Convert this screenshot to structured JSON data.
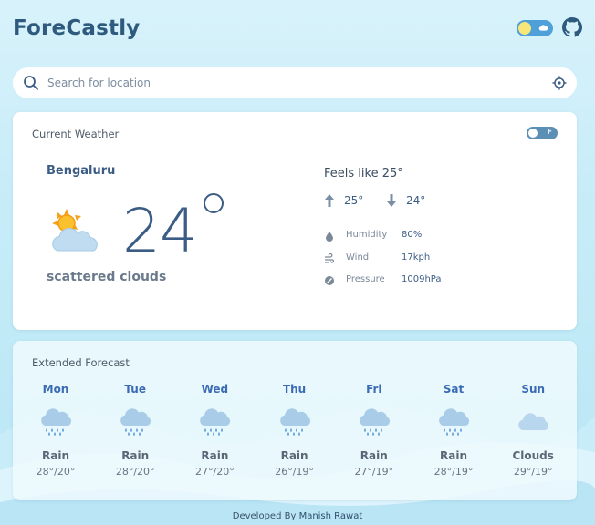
{
  "app": {
    "title": "ForeCastly"
  },
  "header": {
    "theme_toggle_icon": "sun-cloud-toggle-icon",
    "github_icon": "github-icon"
  },
  "search": {
    "placeholder": "Search for location",
    "value": ""
  },
  "current": {
    "title": "Current Weather",
    "unit_toggle_label": "F",
    "city": "Bengaluru",
    "temperature": "24",
    "description": "scattered clouds",
    "feels_like": "Feels like 25°",
    "max_temp": "25°",
    "min_temp": "24°",
    "stats": [
      {
        "label": "Humidity",
        "value": "80%",
        "icon": "droplet-icon"
      },
      {
        "label": "Wind",
        "value": "17kph",
        "icon": "wind-icon"
      },
      {
        "label": "Pressure",
        "value": "1009hPa",
        "icon": "gauge-icon"
      }
    ]
  },
  "forecast": {
    "title": "Extended Forecast",
    "days": [
      {
        "day": "Mon",
        "condition": "Rain",
        "temps": "28°/20°",
        "icon": "rain-cloud-icon"
      },
      {
        "day": "Tue",
        "condition": "Rain",
        "temps": "28°/20°",
        "icon": "rain-cloud-icon"
      },
      {
        "day": "Wed",
        "condition": "Rain",
        "temps": "27°/20°",
        "icon": "rain-cloud-icon"
      },
      {
        "day": "Thu",
        "condition": "Rain",
        "temps": "26°/19°",
        "icon": "rain-cloud-icon"
      },
      {
        "day": "Fri",
        "condition": "Rain",
        "temps": "27°/19°",
        "icon": "rain-cloud-icon"
      },
      {
        "day": "Sat",
        "condition": "Rain",
        "temps": "28°/19°",
        "icon": "rain-cloud-icon"
      },
      {
        "day": "Sun",
        "condition": "Clouds",
        "temps": "29°/19°",
        "icon": "cloud-icon"
      }
    ]
  },
  "footer": {
    "prefix": "Developed By",
    "author": "Manish Rawat"
  },
  "colors": {
    "brand": "#2e5a7e",
    "accent": "#3b5d85",
    "day_label": "#3b6bb5",
    "background": "#c6ecf8"
  }
}
